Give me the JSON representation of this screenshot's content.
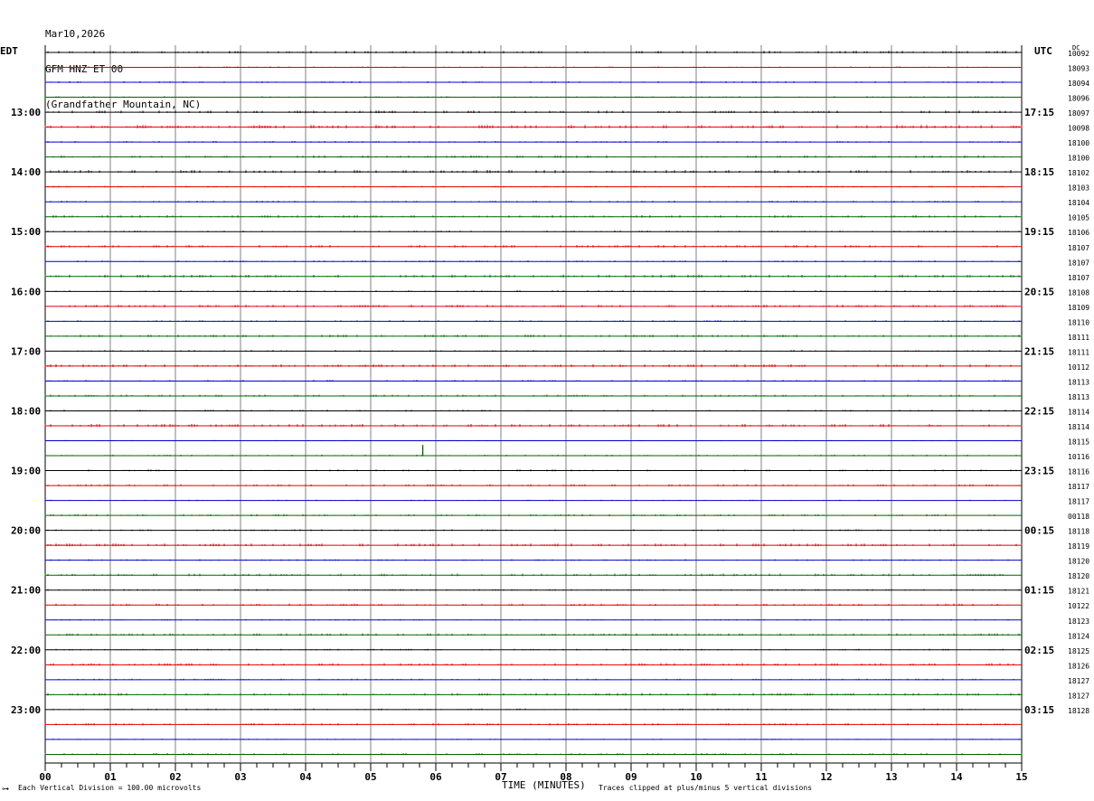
{
  "header": {
    "date": "Mar10,2026",
    "station": "GFM HNZ ET 00",
    "location": "(Grandfather Mountain, NC)"
  },
  "left_timezone": "EDT",
  "right_timezone": "UTC",
  "corner_label": "DC",
  "footer": {
    "corner_mark": "⊶",
    "scale_note": "Each Vertical Division = 100.00 microvolts",
    "clip_note": "Traces clipped at plus/minus 5 vertical divisions"
  },
  "colors": {
    "trace_cycle": [
      "#000000",
      "#dd0000",
      "#0000cc",
      "#006600"
    ],
    "grid_vertical": "#808080",
    "axis": "#000000"
  },
  "chart_data": {
    "type": "line",
    "title": "",
    "xlabel": "TIME (MINUTES)",
    "xlim": [
      0,
      15
    ],
    "x_ticks": [
      "00",
      "01",
      "02",
      "03",
      "04",
      "05",
      "06",
      "07",
      "08",
      "09",
      "10",
      "11",
      "12",
      "13",
      "14",
      "15"
    ],
    "minor_ticks_per_minute": 4,
    "num_traces": 48,
    "left_hour_labels": [
      {
        "trace": 4,
        "label": "13:00"
      },
      {
        "trace": 8,
        "label": "14:00"
      },
      {
        "trace": 12,
        "label": "15:00"
      },
      {
        "trace": 16,
        "label": "16:00"
      },
      {
        "trace": 20,
        "label": "17:00"
      },
      {
        "trace": 24,
        "label": "18:00"
      },
      {
        "trace": 28,
        "label": "19:00"
      },
      {
        "trace": 32,
        "label": "20:00"
      },
      {
        "trace": 36,
        "label": "21:00"
      },
      {
        "trace": 40,
        "label": "22:00"
      },
      {
        "trace": 44,
        "label": "23:00"
      }
    ],
    "right_hour_labels": [
      {
        "trace": 4,
        "label": "17:15"
      },
      {
        "trace": 8,
        "label": "18:15"
      },
      {
        "trace": 12,
        "label": "19:15"
      },
      {
        "trace": 16,
        "label": "20:15"
      },
      {
        "trace": 20,
        "label": "21:15"
      },
      {
        "trace": 24,
        "label": "22:15"
      },
      {
        "trace": 28,
        "label": "23:15"
      },
      {
        "trace": 32,
        "label": "00:15"
      },
      {
        "trace": 36,
        "label": "01:15"
      },
      {
        "trace": 40,
        "label": "02:15"
      },
      {
        "trace": 44,
        "label": "03:15"
      }
    ],
    "dc_values": [
      "10092",
      "18093",
      "18094",
      "18096",
      "18097",
      "10098",
      "18100",
      "18100",
      "18102",
      "18103",
      "18104",
      "10105",
      "18106",
      "18107",
      "18107",
      "18107",
      "18108",
      "18109",
      "18110",
      "18111",
      "18111",
      "10112",
      "18113",
      "18113",
      "18114",
      "18114",
      "18115",
      "10116",
      "18116",
      "18117",
      "18117",
      "00118",
      "18118",
      "18119",
      "18120",
      "18120",
      "18121",
      "10122",
      "18123",
      "18124",
      "18125",
      "18126",
      "18127",
      "18127",
      "18128"
    ],
    "noise_amplitude": [
      0.6,
      0.4,
      0.4,
      0.4,
      0.6,
      0.8,
      0.4,
      0.6,
      0.7,
      0.4,
      0.4,
      0.6,
      0.4,
      0.6,
      0.4,
      0.7,
      0.4,
      0.6,
      0.4,
      0.6,
      0.4,
      0.7,
      0.4,
      0.5,
      0.4,
      0.7,
      0.3,
      0.4,
      0.4,
      0.5,
      0.3,
      0.5,
      0.4,
      0.7,
      0.4,
      0.6,
      0.4,
      0.5,
      0.3,
      0.6,
      0.4,
      0.6,
      0.4,
      0.6,
      0.4,
      0.5,
      0.3,
      0.5
    ],
    "events": [
      {
        "trace": 27,
        "minute": 5.8,
        "amplitude_divisions": -0.8
      }
    ]
  }
}
